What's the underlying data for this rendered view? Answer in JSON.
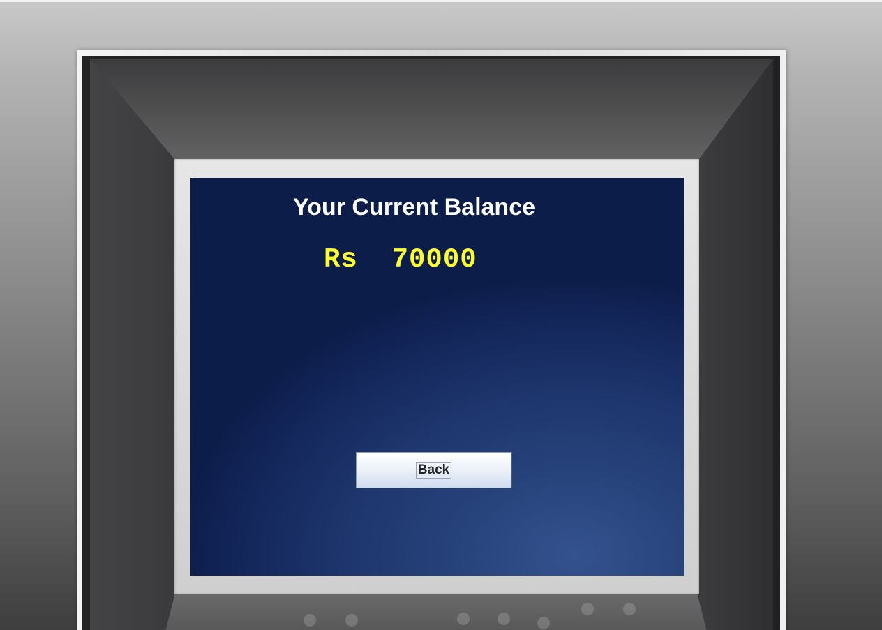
{
  "screen": {
    "title": "Your Current Balance",
    "balance_text": "Rs  70000",
    "back_button_label": "Back"
  },
  "colors": {
    "screen_background": "#1d356b",
    "title_color": "#ffffff",
    "balance_color": "#ffff33"
  }
}
